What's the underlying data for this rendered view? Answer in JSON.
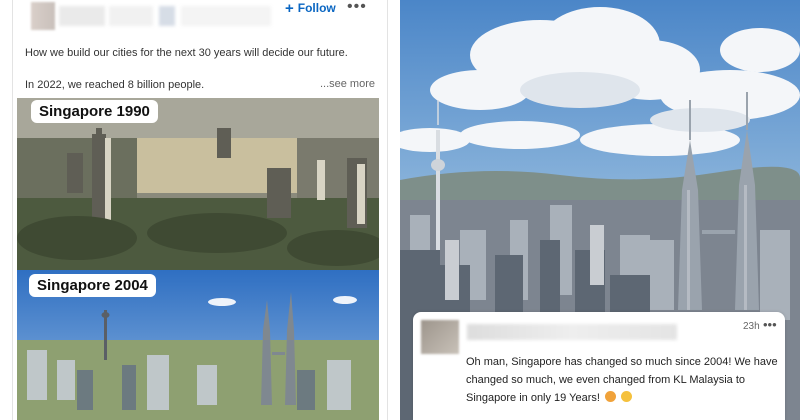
{
  "post": {
    "follow_plus": "+",
    "follow_label": "Follow",
    "more_label": "•••",
    "line1": "How we build our cities for the next 30 years will decide our future.",
    "line2": "In 2022, we reached 8 billion people.",
    "see_more": "...see more",
    "photo1_label": "Singapore  1990",
    "photo2_label": "Singapore  2004"
  },
  "comment": {
    "time": "23h",
    "more_label": "•••",
    "text": "Oh man, Singapore has changed so much since 2004! We have changed so much, we even changed from KL Malaysia to Singapore in only 19 Years!"
  },
  "icons": {
    "emoji1": "hot-face-emoji-icon",
    "emoji2": "laughing-emoji-icon"
  },
  "colors": {
    "follow_blue": "#0a66c2",
    "sky_blue": "#3c7fc7"
  }
}
